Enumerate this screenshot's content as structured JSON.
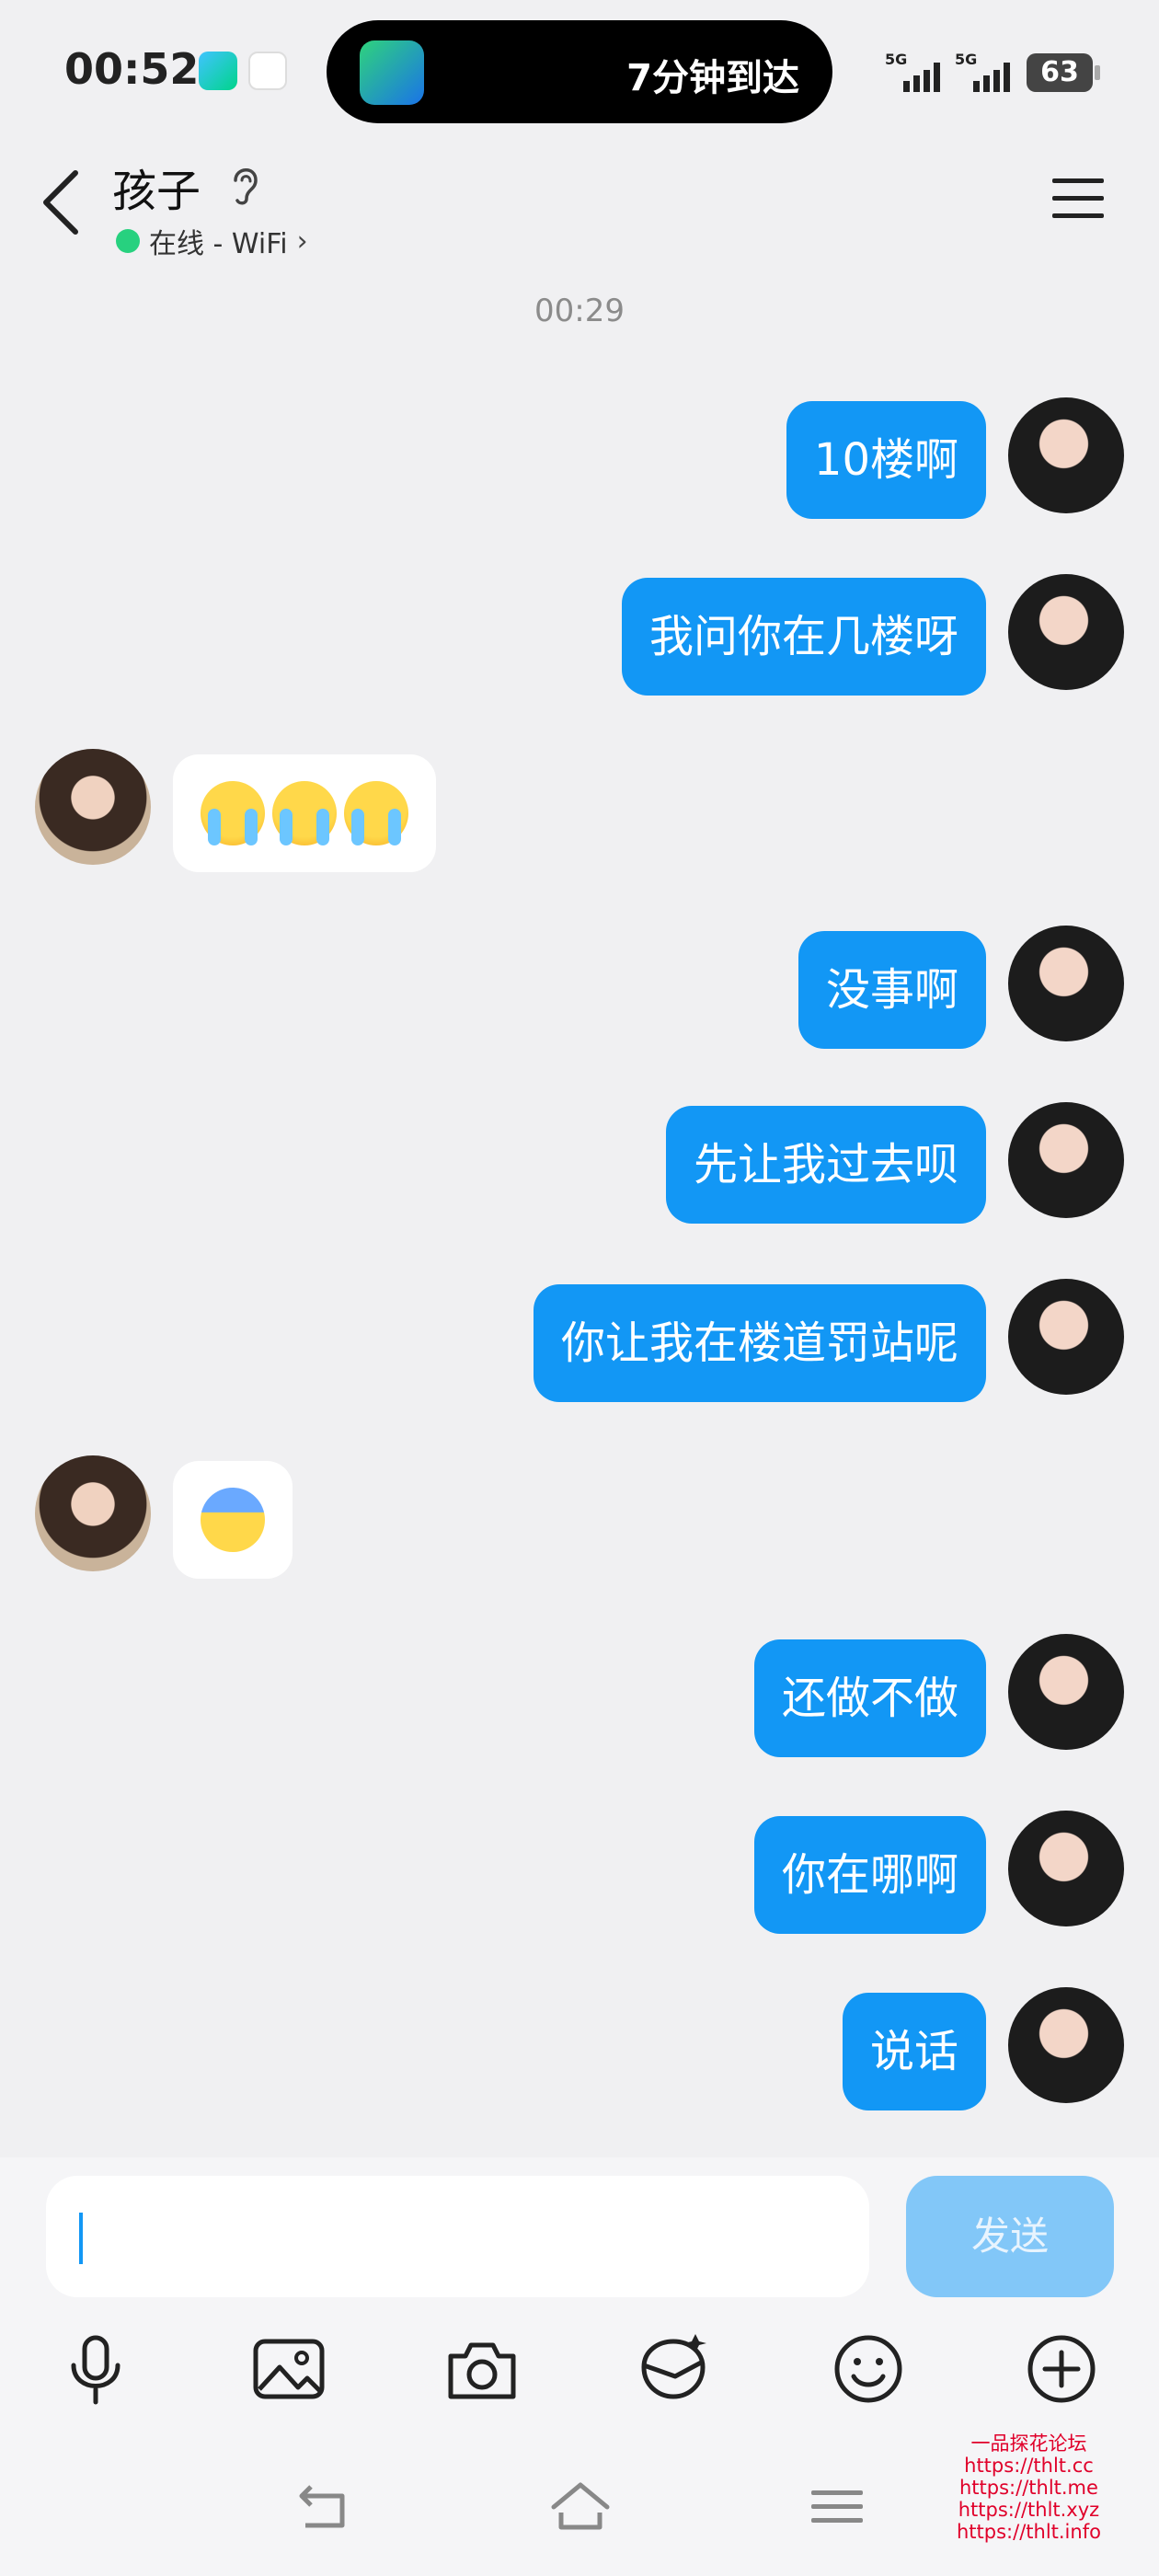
{
  "status_bar": {
    "time": "00:52",
    "island_text": "7分钟到达",
    "signal_1": "5G",
    "signal_2": "5G",
    "battery": "63"
  },
  "header": {
    "title": "孩子",
    "subtitle": "在线 - WiFi",
    "chevron": "›"
  },
  "timestamp": "00:29",
  "messages": [
    {
      "side": "out",
      "text": "10楼啊"
    },
    {
      "side": "out",
      "text": "我问你在几楼呀"
    },
    {
      "side": "in",
      "emoji": [
        "loudly-crying-face",
        "loudly-crying-face",
        "loudly-crying-face"
      ]
    },
    {
      "side": "out",
      "text": "没事啊"
    },
    {
      "side": "out",
      "text": "先让我过去呗"
    },
    {
      "side": "out",
      "text": "你让我在楼道罚站呢"
    },
    {
      "side": "in",
      "emoji": [
        "face-screaming-in-fear"
      ]
    },
    {
      "side": "out",
      "text": "还做不做"
    },
    {
      "side": "out",
      "text": "你在哪啊"
    },
    {
      "side": "out",
      "text": "说话"
    }
  ],
  "composer": {
    "input_value": "",
    "send_label": "发送"
  },
  "toolbar": [
    "microphone-icon",
    "image-icon",
    "camera-icon",
    "red-packet-icon",
    "emoji-icon",
    "plus-icon"
  ],
  "watermark": [
    "一品探花论坛",
    "https://thlt.cc",
    "https://thlt.me",
    "https://thlt.xyz",
    "https://thlt.info"
  ],
  "colors": {
    "outgoing_bubble": "#1297f5",
    "incoming_bubble": "#ffffff",
    "background": "#f0f0f2",
    "send_button": "#82c7f8",
    "online_dot": "#27d17f"
  }
}
